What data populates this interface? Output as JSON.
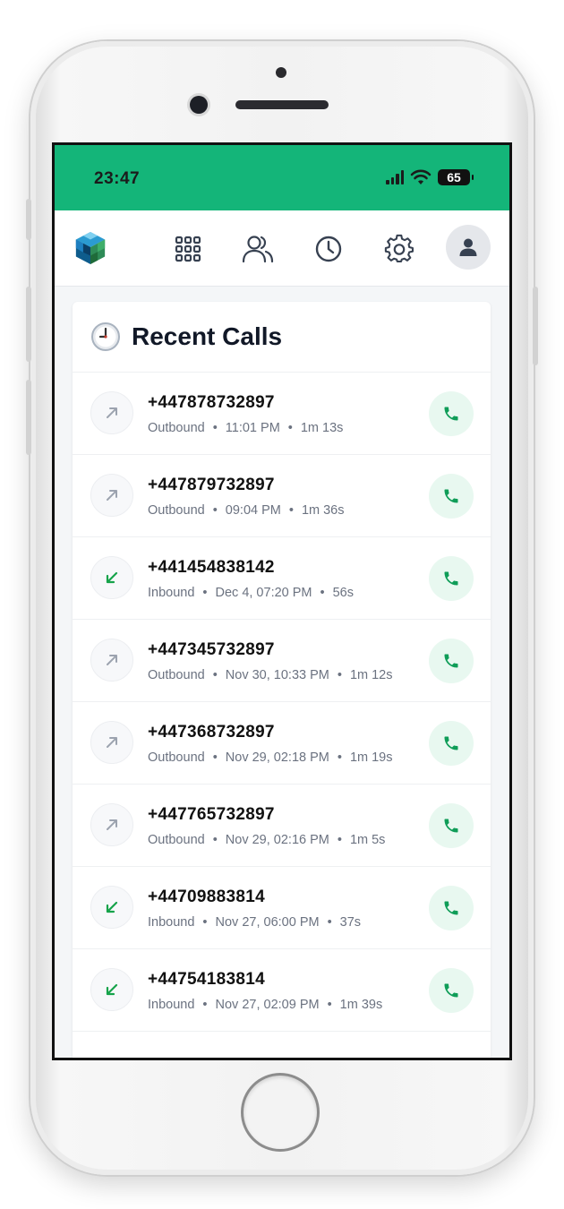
{
  "status_bar": {
    "time": "23:47",
    "battery": "65",
    "background_color": "#14b579"
  },
  "header": {
    "logo_icon": "cube-logo",
    "nav": [
      {
        "name": "dialpad-icon"
      },
      {
        "name": "contacts-icon"
      },
      {
        "name": "recent-clock-icon"
      },
      {
        "name": "settings-gear-icon"
      }
    ],
    "avatar_icon": "user-avatar-icon"
  },
  "recent_calls": {
    "title": "Recent Calls",
    "title_icon": "clock-emoji-icon",
    "accent_color": "#0f9d58",
    "items": [
      {
        "number": "+447878732897",
        "direction": "Outbound",
        "time": "11:01 PM",
        "duration": "1m 13s"
      },
      {
        "number": "+447879732897",
        "direction": "Outbound",
        "time": "09:04 PM",
        "duration": "1m 36s"
      },
      {
        "number": "+441454838142",
        "direction": "Inbound",
        "time": "Dec 4, 07:20 PM",
        "duration": "56s"
      },
      {
        "number": "+447345732897",
        "direction": "Outbound",
        "time": "Nov 30, 10:33 PM",
        "duration": "1m 12s"
      },
      {
        "number": "+447368732897",
        "direction": "Outbound",
        "time": "Nov 29, 02:18 PM",
        "duration": "1m 19s"
      },
      {
        "number": "+447765732897",
        "direction": "Outbound",
        "time": "Nov 29, 02:16 PM",
        "duration": "1m 5s"
      },
      {
        "number": "+44709883814",
        "direction": "Inbound",
        "time": "Nov 27, 06:00 PM",
        "duration": "37s"
      },
      {
        "number": "+44754183814",
        "direction": "Inbound",
        "time": "Nov 27, 02:09 PM",
        "duration": "1m 39s"
      }
    ]
  }
}
